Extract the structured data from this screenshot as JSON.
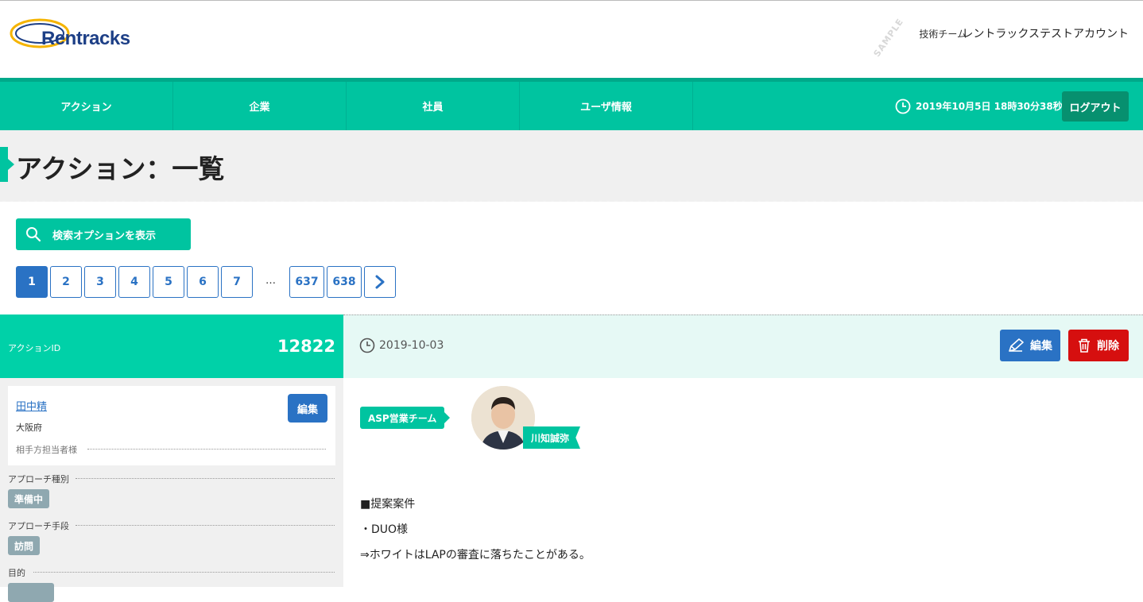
{
  "header": {
    "logo_text": "Rentracks",
    "watermark": "SAMPLE",
    "team": "技術チーム",
    "account": "レントラックステストアカウント"
  },
  "nav": {
    "items": [
      "アクション",
      "企業",
      "社員",
      "ユーザ情報"
    ],
    "datetime": "2019年10月5日 18時30分38秒",
    "logout_label": "ログアウト"
  },
  "page_title": "アクション：一覧",
  "search_button_label": "検索オプションを表示",
  "pagination": {
    "pages": [
      "1",
      "2",
      "3",
      "4",
      "5",
      "6",
      "7"
    ],
    "ellipsis": "…",
    "last_pages": [
      "637",
      "638"
    ],
    "active": "1"
  },
  "record": {
    "id_label": "アクションID",
    "id": "12822",
    "date": "2019-10-03",
    "edit_label": "編集",
    "delete_label": "削除",
    "contact": {
      "name": "田中精",
      "prefecture": "大阪府",
      "role": "相手方担当者様",
      "edit_label": "編集"
    },
    "fields": [
      {
        "label": "アプローチ種別",
        "value": "準備中"
      },
      {
        "label": "アプローチ手段",
        "value": "訪問"
      },
      {
        "label": "目的",
        "value": ""
      }
    ],
    "team": "ASP営業チーム",
    "staff": "川知誠弥",
    "notes": [
      "■提案案件",
      "・DUO様",
      "⇒ホワイトはLAPの審査に落ちたことがある。"
    ]
  },
  "colors": {
    "accent": "#00c4a0",
    "primary": "#2a72c4",
    "danger": "#d60f0f"
  }
}
